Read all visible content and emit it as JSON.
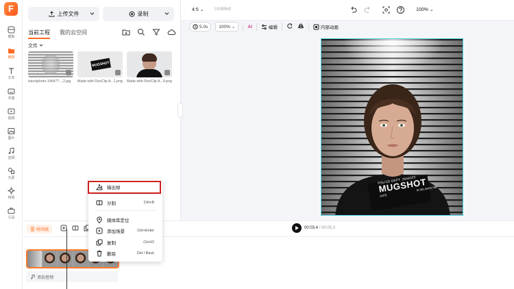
{
  "app": {
    "logo_letter": "F",
    "accent": "#ff6a1f",
    "highlight": "#d01f1f",
    "canvas_border": "#4cd3e6"
  },
  "rail": [
    {
      "name": "template",
      "label": "模板",
      "icon": "grid-icon"
    },
    {
      "name": "media",
      "label": "媒体",
      "icon": "folder-icon",
      "active": true
    },
    {
      "name": "text",
      "label": "文本",
      "icon": "text-icon"
    },
    {
      "name": "subtitle",
      "label": "字幕",
      "icon": "subtitle-icon"
    },
    {
      "name": "video",
      "label": "视频",
      "icon": "video-icon"
    },
    {
      "name": "image",
      "label": "图片",
      "icon": "image-icon"
    },
    {
      "name": "audio",
      "label": "音频",
      "icon": "music-icon"
    },
    {
      "name": "elements",
      "label": "元素",
      "icon": "shapes-icon"
    },
    {
      "name": "effects",
      "label": "特效",
      "icon": "effects-icon"
    },
    {
      "name": "tools",
      "label": "工具",
      "icon": "toolbox-icon"
    }
  ],
  "panel": {
    "upload_label": "上传文件",
    "record_label": "录制",
    "tab_project": "当前工程",
    "tab_cloud": "我的云空间",
    "files_label": "文件",
    "files": [
      {
        "name": "istockphoto-146477....2.jpg"
      },
      {
        "name": "Made with FlexClip A...1.png",
        "badge": "MUGSHOT"
      },
      {
        "name": "Made with FlexClip A...9.png"
      }
    ]
  },
  "topbar": {
    "ratio": "4:5",
    "title": "Untitled",
    "zoom": "100%"
  },
  "toolbar": {
    "duration": "5.0s",
    "scale": "100%",
    "edit_label": "编辑",
    "anim_label": "内部动画"
  },
  "canvas": {
    "sign_line1": "POLICE DEPT. 28A8321",
    "sign_title": "MUGSHOT",
    "sign_date": "DATE",
    "sign_no": "ID NO.34437798"
  },
  "timeline": {
    "tag": "时间线",
    "current_time": "00:03.4",
    "total_time": "/ 00:05.0",
    "add_audio": "添加音频"
  },
  "context_menu": [
    {
      "name": "export-frame",
      "label": "输出帧",
      "shortcut": "",
      "icon": "export-frame-icon"
    },
    {
      "name": "split",
      "label": "分割",
      "shortcut": "Ctrl+B",
      "icon": "split-icon"
    },
    {
      "name": "locate-in-library",
      "label": "媒体库定位",
      "shortcut": "",
      "icon": "location-icon"
    },
    {
      "name": "add-scene",
      "label": "添加场景",
      "shortcut": "Ctrl+Enter",
      "icon": "add-scene-icon"
    },
    {
      "name": "copy",
      "label": "复制",
      "shortcut": "Ctrl+D",
      "icon": "copy-icon"
    },
    {
      "name": "delete",
      "label": "删除",
      "shortcut": "Del / Back",
      "icon": "trash-icon"
    }
  ]
}
